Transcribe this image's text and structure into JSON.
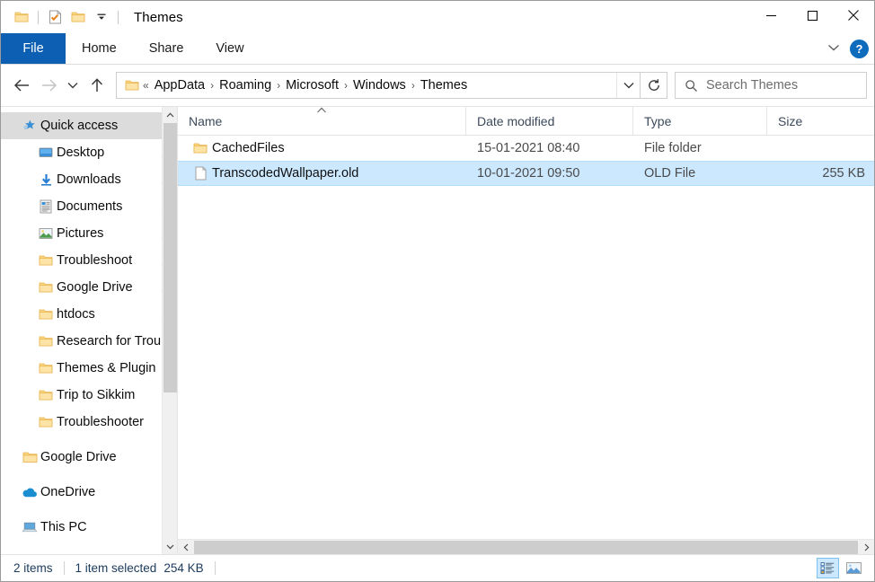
{
  "window": {
    "title": "Themes",
    "quick_access_toolbar": [
      {
        "name": "folder-icon",
        "label": "Properties folder"
      },
      {
        "name": "properties-icon",
        "label": "Properties"
      },
      {
        "name": "new-folder-icon",
        "label": "New folder"
      },
      {
        "name": "chevron-down-icon",
        "label": "Customize Quick Access Toolbar"
      }
    ],
    "caption_buttons": {
      "minimize": "—",
      "maximize": "☐",
      "close": "✕"
    }
  },
  "ribbon": {
    "tabs": [
      {
        "label": "File",
        "active": true
      },
      {
        "label": "Home",
        "active": false
      },
      {
        "label": "Share",
        "active": false
      },
      {
        "label": "View",
        "active": false
      }
    ],
    "collapse_icon": "chevron-down-icon",
    "help_label": "?"
  },
  "navigation": {
    "back_icon": "arrow-left-icon",
    "forward_icon": "arrow-right-icon",
    "recent_icon": "chevron-down-icon",
    "up_icon": "arrow-up-icon",
    "back_enabled": true,
    "forward_enabled": false
  },
  "address_bar": {
    "overflow_indicator": "«",
    "crumbs": [
      "AppData",
      "Roaming",
      "Microsoft",
      "Windows",
      "Themes"
    ],
    "separator": "›",
    "dropdown_icon": "chevron-down-icon",
    "refresh_icon": "refresh-icon"
  },
  "search": {
    "placeholder": "Search Themes",
    "icon": "search-icon",
    "value": ""
  },
  "sidebar": {
    "items": [
      {
        "label": "Quick access",
        "icon": "quick-access-star-icon",
        "level": 0,
        "selected": true,
        "pinned": false
      },
      {
        "label": "Desktop",
        "icon": "desktop-icon",
        "level": 1,
        "selected": false,
        "pinned": true
      },
      {
        "label": "Downloads",
        "icon": "downloads-icon",
        "level": 1,
        "selected": false,
        "pinned": true
      },
      {
        "label": "Documents",
        "icon": "documents-icon",
        "level": 1,
        "selected": false,
        "pinned": true
      },
      {
        "label": "Pictures",
        "icon": "pictures-icon",
        "level": 1,
        "selected": false,
        "pinned": true
      },
      {
        "label": "Troubleshoot",
        "icon": "folder-icon",
        "level": 1,
        "selected": false,
        "pinned": true
      },
      {
        "label": "Google Drive",
        "icon": "folder-icon",
        "level": 1,
        "selected": false,
        "pinned": true
      },
      {
        "label": "htdocs",
        "icon": "folder-icon",
        "level": 1,
        "selected": false,
        "pinned": true
      },
      {
        "label": "Research for Trou",
        "icon": "folder-icon",
        "level": 1,
        "selected": false,
        "pinned": false
      },
      {
        "label": "Themes & Plugin",
        "icon": "folder-icon",
        "level": 1,
        "selected": false,
        "pinned": false
      },
      {
        "label": "Trip to Sikkim",
        "icon": "folder-icon",
        "level": 1,
        "selected": false,
        "pinned": false
      },
      {
        "label": "Troubleshooter",
        "icon": "folder-icon",
        "level": 1,
        "selected": false,
        "pinned": false
      },
      {
        "label": "Google Drive",
        "icon": "folder-icon",
        "level": 0,
        "selected": false,
        "pinned": false
      },
      {
        "label": "OneDrive",
        "icon": "onedrive-icon",
        "level": 0,
        "selected": false,
        "pinned": false
      },
      {
        "label": "This PC",
        "icon": "this-pc-icon",
        "level": 0,
        "selected": false,
        "pinned": false
      }
    ],
    "scroll_up_icon": "chevron-up-icon",
    "scroll_down_icon": "chevron-down-icon"
  },
  "file_list": {
    "columns": [
      {
        "label": "Name",
        "sorted": "asc"
      },
      {
        "label": "Date modified",
        "sorted": ""
      },
      {
        "label": "Type",
        "sorted": ""
      },
      {
        "label": "Size",
        "sorted": ""
      }
    ],
    "rows": [
      {
        "name": "CachedFiles",
        "date": "15-01-2021 08:40",
        "type": "File folder",
        "size": "",
        "icon": "folder-icon",
        "selected": false
      },
      {
        "name": "TranscodedWallpaper.old",
        "date": "10-01-2021 09:50",
        "type": "OLD File",
        "size": "255 KB",
        "icon": "file-icon",
        "selected": true
      }
    ]
  },
  "horizontal_scrollbar": {
    "left_icon": "chevron-left-icon",
    "right_icon": "chevron-right-icon"
  },
  "status_bar": {
    "item_count": "2 items",
    "selection": "1 item selected",
    "selection_size": "254 KB",
    "view_buttons": [
      {
        "name": "details-view-button",
        "active": true
      },
      {
        "name": "large-icons-view-button",
        "active": false
      }
    ]
  },
  "colors": {
    "accent": "#0c5fb3",
    "selection": "#cce8ff",
    "folder": "#ffd476",
    "help_blue": "#0f6cbd"
  }
}
